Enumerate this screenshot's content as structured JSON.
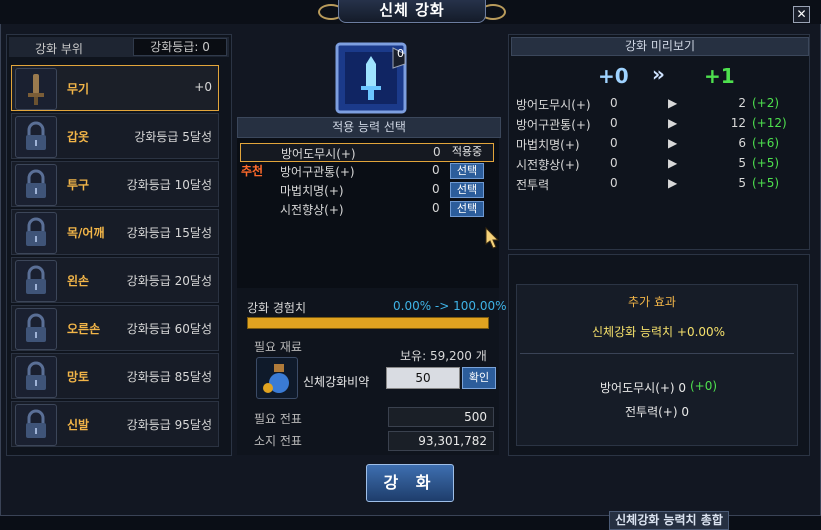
{
  "window": {
    "title": "신체 강화",
    "close": "✕"
  },
  "left": {
    "header": "강화 부위",
    "grade": "강화등급: 0",
    "slots": [
      {
        "name": "무기",
        "req": "+0",
        "icon": "sword-icon"
      },
      {
        "name": "갑옷",
        "req": "강화등급 5달성",
        "icon": "lock-icon"
      },
      {
        "name": "투구",
        "req": "강화등급 10달성",
        "icon": "lock-icon"
      },
      {
        "name": "목/어깨",
        "req": "강화등급 15달성",
        "icon": "lock-icon"
      },
      {
        "name": "왼손",
        "req": "강화등급 20달성",
        "icon": "lock-icon"
      },
      {
        "name": "오른손",
        "req": "강화등급 60달성",
        "icon": "lock-icon"
      },
      {
        "name": "망토",
        "req": "강화등급 85달성",
        "icon": "lock-icon"
      },
      {
        "name": "신발",
        "req": "강화등급 95달성",
        "icon": "lock-icon"
      }
    ]
  },
  "emblem": {
    "level": "0",
    "icon": "sword-emblem-icon"
  },
  "ability": {
    "header": "적용 능력 선택",
    "recommend": "추천",
    "rows": [
      {
        "name": "방어도무시(+)",
        "value": "0",
        "button": "적용중"
      },
      {
        "name": "방어구관통(+)",
        "value": "0",
        "button": "선택"
      },
      {
        "name": "마법치명(+)",
        "value": "0",
        "button": "선택"
      },
      {
        "name": "시전향상(+)",
        "value": "0",
        "button": "선택"
      }
    ]
  },
  "exp": {
    "label": "강화 경험치",
    "value": "0.00% -> 100.00%",
    "fill": 1.0
  },
  "material": {
    "label": "필요 재료",
    "owned": "보유: 59,200 개",
    "name": "신체강화비약",
    "qty": "50",
    "confirm": "확인"
  },
  "cost": {
    "need_label": "필요 전표",
    "need": "500",
    "have_label": "소지 전표",
    "have": "93,301,782"
  },
  "enhance_button": "강 화",
  "preview": {
    "header": "강화 미리보기",
    "from": "+0",
    "arrow": "»",
    "to": "+1",
    "rows": [
      {
        "name": "방어도무시(+)",
        "cur": "0",
        "next": "2",
        "inc": "(+2)"
      },
      {
        "name": "방어구관통(+)",
        "cur": "0",
        "next": "12",
        "inc": "(+12)"
      },
      {
        "name": "마법치명(+)",
        "cur": "0",
        "next": "6",
        "inc": "(+6)"
      },
      {
        "name": "시전향상(+)",
        "cur": "0",
        "next": "5",
        "inc": "(+5)"
      },
      {
        "name": "전투력",
        "cur": "0",
        "next": "5",
        "inc": "(+5)"
      }
    ]
  },
  "summary": {
    "header": "신체강화 능력치 총합",
    "extra_label": "추가 효과",
    "extra_value": "신체강화 능력치 +0.00%",
    "line1_label": "방어도무시(+) 0",
    "line1_inc": "(+0)",
    "line2": "전투력(+) 0"
  },
  "colors": {
    "accent": "#f2b548",
    "green": "#4ee04e",
    "blue": "#3fb3e6",
    "button": "#2c5d9b"
  }
}
